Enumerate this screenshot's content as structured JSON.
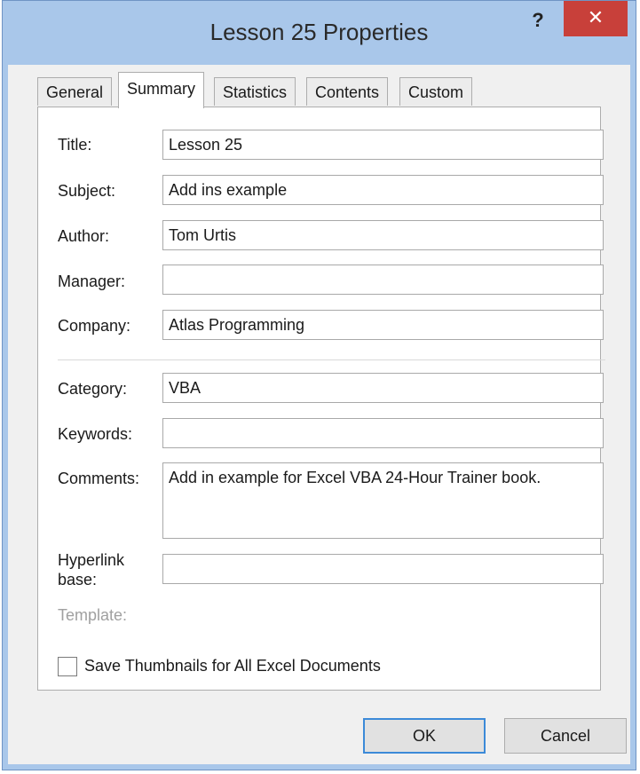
{
  "window": {
    "title": "Lesson 25 Properties",
    "help_label": "?",
    "close_label": "✕"
  },
  "tabs": [
    {
      "label": "General"
    },
    {
      "label": "Summary"
    },
    {
      "label": "Statistics"
    },
    {
      "label": "Contents"
    },
    {
      "label": "Custom"
    }
  ],
  "fields": {
    "title": {
      "label": "Title:",
      "value": "Lesson 25"
    },
    "subject": {
      "label": "Subject:",
      "value": "Add ins example"
    },
    "author": {
      "label": "Author:",
      "value": "Tom Urtis"
    },
    "manager": {
      "label": "Manager:",
      "value": ""
    },
    "company": {
      "label": "Company:",
      "value": "Atlas Programming"
    },
    "category": {
      "label": "Category:",
      "value": "VBA"
    },
    "keywords": {
      "label": "Keywords:",
      "value": ""
    },
    "comments": {
      "label": "Comments:",
      "value": "Add in example for Excel VBA 24-Hour Trainer book."
    },
    "hyperlink_base": {
      "label_line1": "Hyperlink",
      "label_line2": "base:",
      "value": ""
    },
    "template": {
      "label": "Template:"
    }
  },
  "checkbox": {
    "label": "Save Thumbnails for All Excel Documents",
    "checked": false
  },
  "buttons": {
    "ok": "OK",
    "cancel": "Cancel"
  },
  "colors": {
    "titlebar": "#a9c7ea",
    "close": "#c8403a",
    "default_button_border": "#3c8ad8"
  }
}
